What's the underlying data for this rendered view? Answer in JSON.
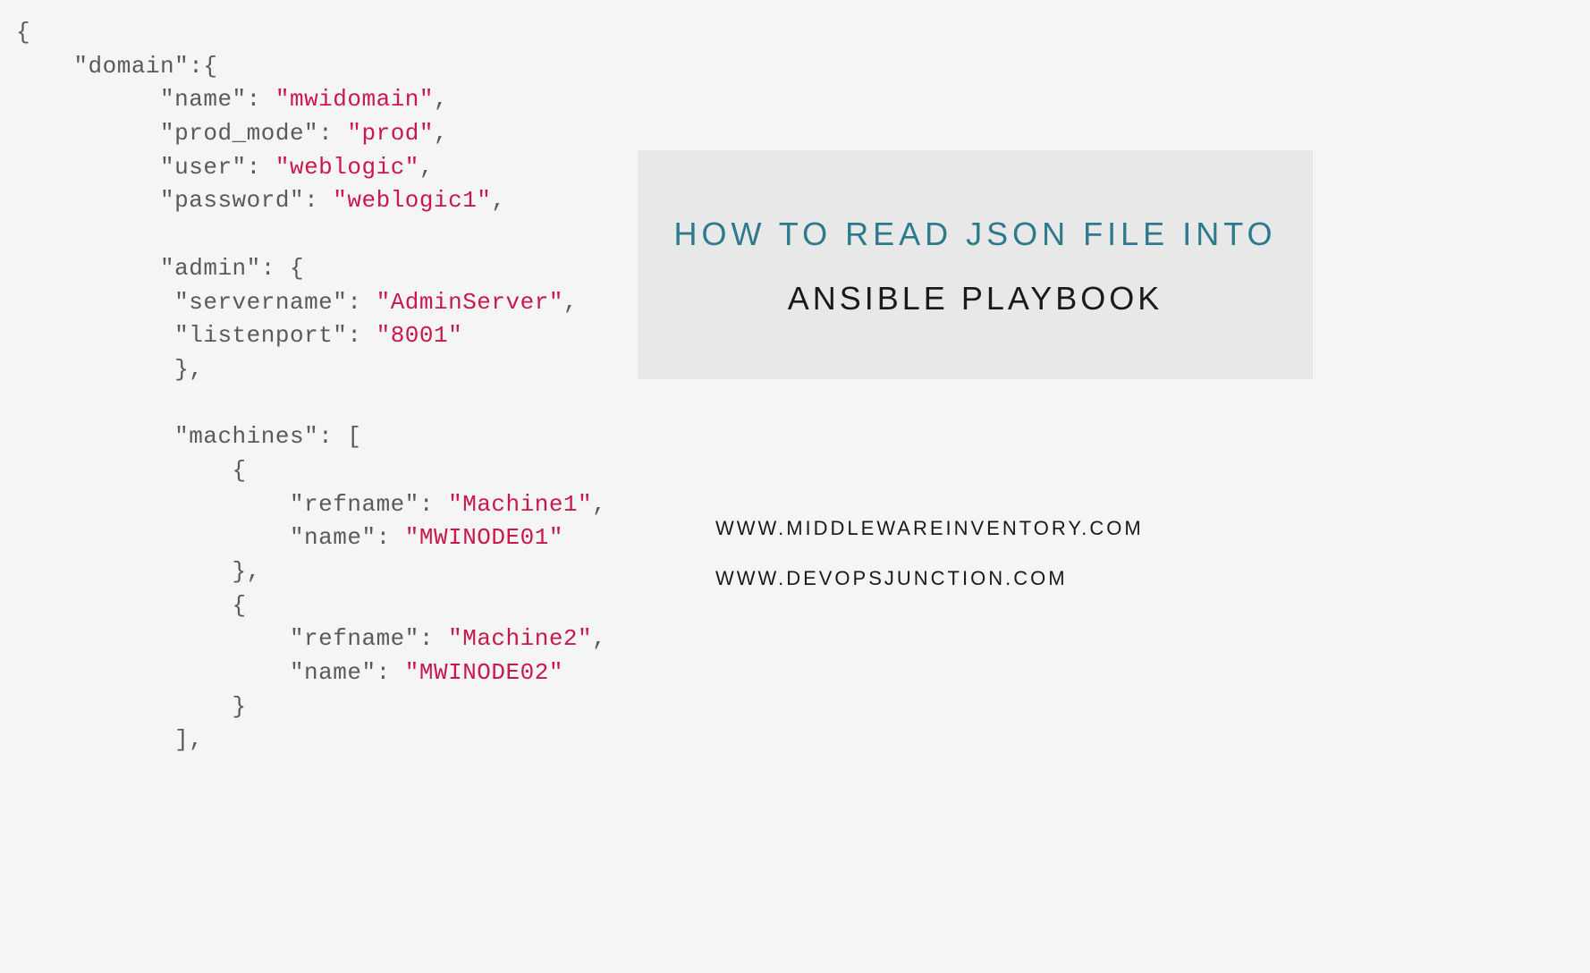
{
  "code": {
    "line1": "{",
    "line2_key": "\"domain\"",
    "line2_rest": ":{",
    "line3_key": "\"name\"",
    "line3_sep": ": ",
    "line3_val": "\"mwidomain\"",
    "line3_end": ",",
    "line4_key": "\"prod_mode\"",
    "line4_sep": ": ",
    "line4_val": "\"prod\"",
    "line4_end": ",",
    "line5_key": "\"user\"",
    "line5_sep": ": ",
    "line5_val": "\"weblogic\"",
    "line5_end": ",",
    "line6_key": "\"password\"",
    "line6_sep": ": ",
    "line6_val": "\"weblogic1\"",
    "line6_end": ",",
    "line8_key": "\"admin\"",
    "line8_rest": ": {",
    "line9_key": "\"servername\"",
    "line9_sep": ": ",
    "line9_val": "\"AdminServer\"",
    "line9_end": ",",
    "line10_key": "\"listenport\"",
    "line10_sep": ": ",
    "line10_val": "\"8001\"",
    "line11": "},",
    "line13_key": "\"machines\"",
    "line13_rest": ": [",
    "line14": "{",
    "line15_key": "\"refname\"",
    "line15_sep": ": ",
    "line15_val": "\"Machine1\"",
    "line15_end": ",",
    "line16_key": "\"name\"",
    "line16_sep": ": ",
    "line16_val": "\"MWINODE01\"",
    "line17": "},",
    "line18": "{",
    "line19_key": "\"refname\"",
    "line19_sep": ": ",
    "line19_val": "\"Machine2\"",
    "line19_end": ",",
    "line20_key": "\"name\"",
    "line20_sep": ": ",
    "line20_val": "\"MWINODE02\"",
    "line21": "}",
    "line22": "],"
  },
  "title": {
    "line1": "HOW TO READ JSON FILE INTO",
    "line2": "ANSIBLE PLAYBOOK"
  },
  "urls": {
    "url1": "WWW.MIDDLEWAREINVENTORY.COM",
    "url2": "WWW.DEVOPSJUNCTION.COM"
  }
}
